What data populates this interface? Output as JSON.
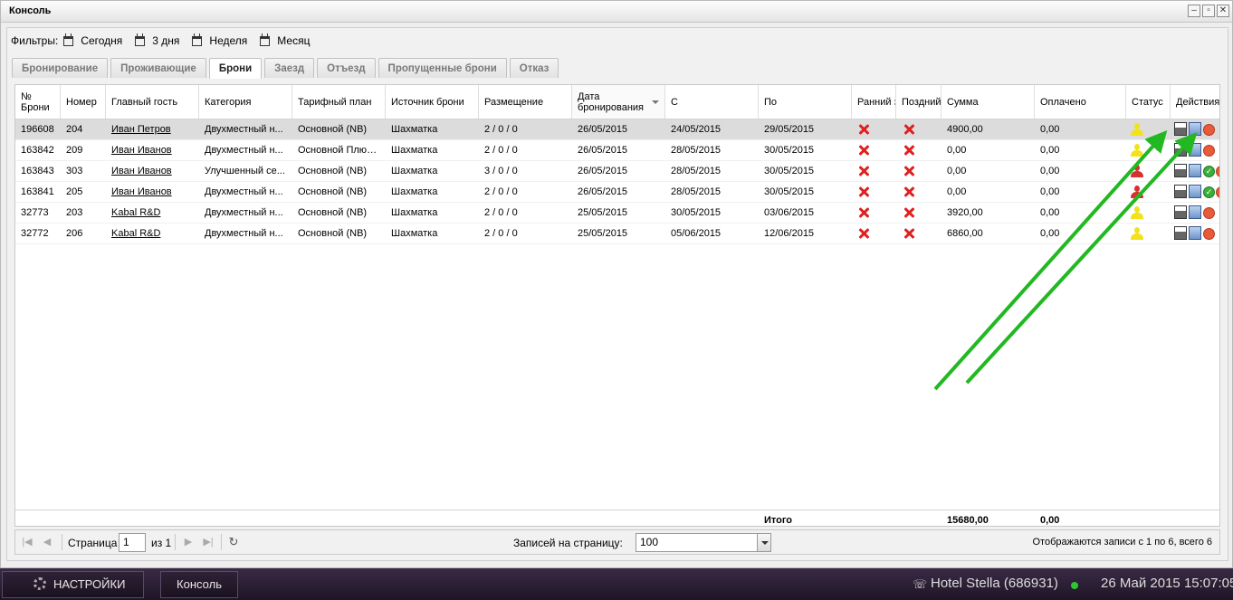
{
  "window": {
    "title": "Консоль",
    "buttons": [
      "–",
      "▫",
      "✕"
    ]
  },
  "filters": {
    "label": "Фильтры:",
    "items": [
      "Сегодня",
      "3 дня",
      "Неделя",
      "Месяц"
    ]
  },
  "tabs": [
    "Бронирование",
    "Проживающие",
    "Брони",
    "Заезд",
    "Отъезд",
    "Пропущенные брони",
    "Отказ"
  ],
  "active_tab": "Брони",
  "table": {
    "columns": [
      "№ Брони",
      "Номер",
      "Главный гость",
      "Категория",
      "Тарифный план",
      "Источник брони",
      "Размещение",
      "Дата бронирования",
      "С",
      "По",
      "Ранний з",
      "Поздний",
      "Сумма",
      "Оплачено",
      "Статус",
      "Действия"
    ],
    "sorted_column": "Дата бронирования",
    "rows": [
      {
        "id": "196608",
        "room": "204",
        "guest": "Иван Петров",
        "category": "Двухместный н...",
        "rate": "Основной (NB)",
        "source": "Шахматка",
        "placement": "2 / 0 / 0",
        "booked": "26/05/2015",
        "from": "24/05/2015",
        "to": "29/05/2015",
        "sum": "4900,00",
        "paid": "0,00",
        "status": "yellow",
        "actions": [
          "printer",
          "card",
          "stop"
        ],
        "selected": true
      },
      {
        "id": "163842",
        "room": "209",
        "guest": "Иван Иванов",
        "category": "Двухместный н...",
        "rate": "Основной Плюс ...",
        "source": "Шахматка",
        "placement": "2 / 0 / 0",
        "booked": "26/05/2015",
        "from": "28/05/2015",
        "to": "30/05/2015",
        "sum": "0,00",
        "paid": "0,00",
        "status": "yellow",
        "actions": [
          "printer",
          "card",
          "stop"
        ],
        "selected": false
      },
      {
        "id": "163843",
        "room": "303",
        "guest": "Иван Иванов",
        "category": "Улучшенный се...",
        "rate": "Основной (NB)",
        "source": "Шахматка",
        "placement": "3 / 0 / 0",
        "booked": "26/05/2015",
        "from": "28/05/2015",
        "to": "30/05/2015",
        "sum": "0,00",
        "paid": "0,00",
        "status": "red",
        "actions": [
          "printer",
          "card",
          "ok",
          "stop"
        ],
        "selected": false
      },
      {
        "id": "163841",
        "room": "205",
        "guest": "Иван Иванов",
        "category": "Двухместный н...",
        "rate": "Основной (NB)",
        "source": "Шахматка",
        "placement": "2 / 0 / 0",
        "booked": "26/05/2015",
        "from": "28/05/2015",
        "to": "30/05/2015",
        "sum": "0,00",
        "paid": "0,00",
        "status": "red",
        "actions": [
          "printer",
          "card",
          "ok",
          "stop"
        ],
        "selected": false
      },
      {
        "id": "32773",
        "room": "203",
        "guest": "Kabal R&D",
        "category": "Двухместный н...",
        "rate": "Основной (NB)",
        "source": "Шахматка",
        "placement": "2 / 0 / 0",
        "booked": "25/05/2015",
        "from": "30/05/2015",
        "to": "03/06/2015",
        "sum": "3920,00",
        "paid": "0,00",
        "status": "yellow",
        "actions": [
          "printer",
          "card",
          "stop"
        ],
        "selected": false
      },
      {
        "id": "32772",
        "room": "206",
        "guest": "Kabal R&D",
        "category": "Двухместный н...",
        "rate": "Основной (NB)",
        "source": "Шахматка",
        "placement": "2 / 0 / 0",
        "booked": "25/05/2015",
        "from": "05/06/2015",
        "to": "12/06/2015",
        "sum": "6860,00",
        "paid": "0,00",
        "status": "yellow",
        "actions": [
          "printer",
          "card",
          "stop"
        ],
        "selected": false
      }
    ],
    "totals": {
      "label": "Итого",
      "sum": "15680,00",
      "paid": "0,00"
    }
  },
  "pager": {
    "page_label": "Страница",
    "page_value": "1",
    "of_label": "из 1",
    "per_page_label": "Записей на страницу:",
    "per_page_value": "100",
    "summary": "Отображаются записи с 1 по 6, всего 6"
  },
  "taskbar": {
    "settings_label": "НАСТРОЙКИ",
    "console_label": "Консоль",
    "hotel": "Hotel Stella (686931)",
    "datetime": "26 Май 2015 15:07:05"
  },
  "colors": {
    "arrow": "#22b822",
    "status_yellow": "#f2e21a",
    "status_red": "#d83030",
    "error_x": "#e02020"
  }
}
